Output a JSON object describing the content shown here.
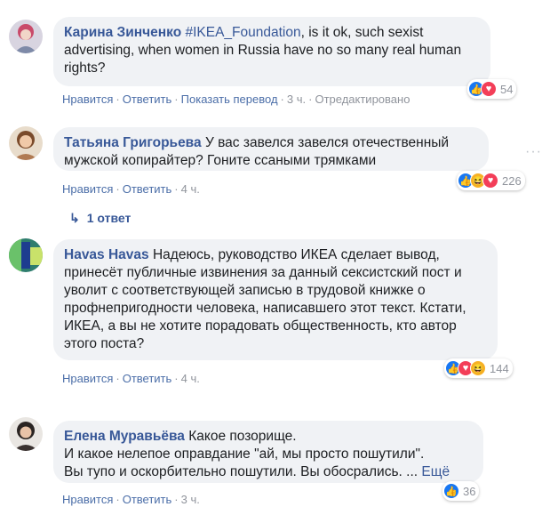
{
  "comments": [
    {
      "author": "Карина Зинченко",
      "tag": "#IKEA_Foundation",
      "text": ", is it ok, such sexist advertising, when women in Russia have no so many real human rights?",
      "actions": {
        "like": "Нравится",
        "reply": "Ответить",
        "translate": "Показать перевод",
        "time": "3 ч.",
        "edited": "Отредактировано"
      },
      "reactions": {
        "icons": [
          "like-icon",
          "love-icon"
        ],
        "count": "54"
      }
    },
    {
      "author": "Татьяна Григорьева",
      "text": "У вас завелся завелся отечественный мужской копирайтер? Гоните ссаными трямками",
      "actions": {
        "like": "Нравится",
        "reply": "Ответить",
        "time": "4 ч."
      },
      "reactions": {
        "icons": [
          "like-icon",
          "haha-icon",
          "love-icon"
        ],
        "count": "226"
      },
      "replies": "1 ответ",
      "more_menu": "···"
    },
    {
      "author": "Havas Havas",
      "text": "Надеюсь, руководство ИКЕА сделает вывод, принесёт публичные извинения за данный сексистский пост и уволит с соответствующей записью в трудовой книжке о профнепригодности человека, написавшего этот текст. Кстати, ИКЕА, а вы не хотите порадовать общественность, кто автор этого поста?",
      "actions": {
        "like": "Нравится",
        "reply": "Ответить",
        "time": "4 ч."
      },
      "reactions": {
        "icons": [
          "like-icon",
          "love-icon",
          "haha-icon"
        ],
        "count": "144"
      }
    },
    {
      "author": "Елена Муравьёва",
      "text_line1": "Какое позорище.",
      "text_line2": "И какое нелепое оправдание \"ай, мы просто пошутили\".",
      "text_line3": "Вы тупо и оскорбительно пошутили. Вы обосрались. ...",
      "more": "Ещё",
      "actions": {
        "like": "Нравится",
        "reply": "Ответить",
        "time": "3 ч."
      },
      "reactions": {
        "icons": [
          "like-icon"
        ],
        "count": "36"
      }
    }
  ],
  "separator": "·",
  "colors": {
    "link": "#385898",
    "bubble": "#f0f2f5",
    "like": "#1877f2",
    "love": "#f33e58",
    "haha": "#f7b125"
  }
}
